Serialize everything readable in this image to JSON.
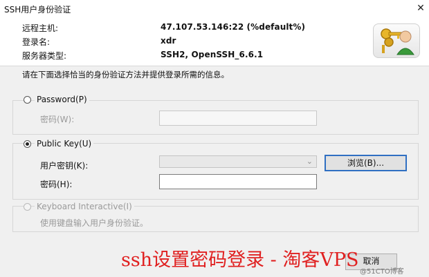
{
  "window": {
    "title": "SSH用户身份验证",
    "close_glyph": "✕"
  },
  "info": {
    "host_label": "远程主机:",
    "host_value": "47.107.53.146:22 (%default%)",
    "user_label": "登录名:",
    "user_value": "xdr",
    "server_label": "服务器类型:",
    "server_value": "SSH2, OpenSSH_6.6.1"
  },
  "intro_text": "请在下面选择恰当的身份验证方法并提供登录所需的信息。",
  "password_section": {
    "label": "Password(P)",
    "selected": false,
    "field_label": "密码(W):",
    "field_value": ""
  },
  "publickey_section": {
    "label": "Public Key(U)",
    "selected": true,
    "key_label": "用户密钥(K):",
    "key_value": "",
    "password_label": "密码(H):",
    "password_value": "",
    "browse_label": "浏览(B)..."
  },
  "keyboard_section": {
    "label": "Keyboard Interactive(I)",
    "selected": false,
    "description": "使用键盘输入用户身份验证。"
  },
  "footer": {
    "cancel_label": "取消"
  },
  "watermark": {
    "text": "ssh设置密码登录 - 淘客VPS",
    "logo_text": "@51CTO博客"
  },
  "colors": {
    "accent": "#2f6fc2",
    "watermark": "#e02020"
  }
}
